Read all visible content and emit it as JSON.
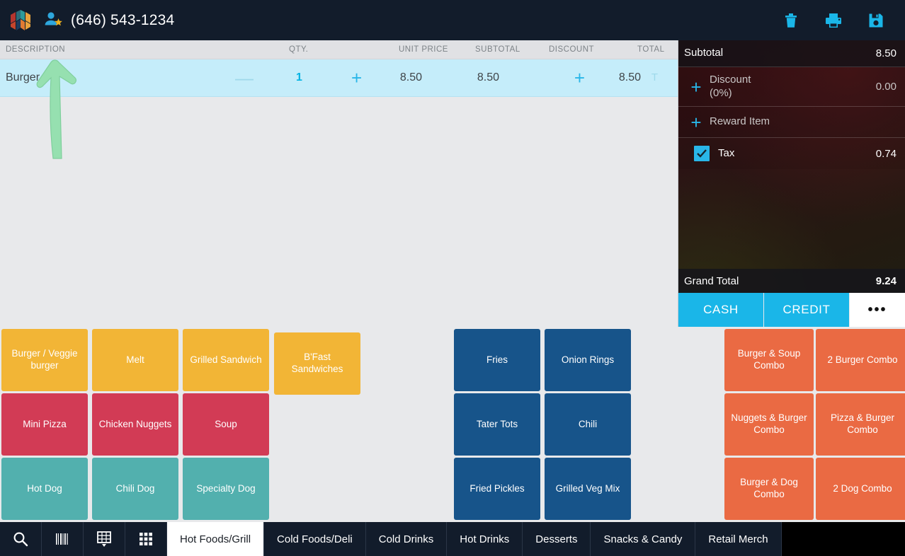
{
  "header": {
    "logo_icon": "leaf-logo-icon",
    "customer_icon": "customer-star-icon",
    "phone_number": "(646) 543-1234",
    "actions": [
      {
        "icon": "trash-icon",
        "label": "Delete"
      },
      {
        "icon": "print-icon",
        "label": "Print"
      },
      {
        "icon": "save-icon",
        "label": "Save"
      }
    ],
    "accent_color": "#1ab6e8",
    "background_color": "#121c2b"
  },
  "ticket": {
    "columns": {
      "description": "DESCRIPTION",
      "qty": "QTY.",
      "unit_price": "UNIT PRICE",
      "subtotal": "SUBTOTAL",
      "discount": "DISCOUNT",
      "total": "TOTAL"
    },
    "rows": [
      {
        "description": "Burger",
        "minus": "—",
        "qty": "1",
        "plus": "+",
        "unit_price": "8.50",
        "subtotal": "8.50",
        "discount_plus": "+",
        "total": "8.50",
        "tax_flag": "T"
      }
    ]
  },
  "totals": {
    "subtotal_label": "Subtotal",
    "subtotal_value": "8.50",
    "discount_label": "Discount",
    "discount_percent": "(0%)",
    "discount_value": "0.00",
    "discount_add": "+",
    "reward_label": "Reward Item",
    "reward_add": "+",
    "tax_label": "Tax",
    "tax_value": "0.74",
    "tax_checked": true,
    "grand_total_label": "Grand Total",
    "grand_total_value": "9.24",
    "cash_label": "CASH",
    "credit_label": "CREDIT",
    "more_label": "•••"
  },
  "grids": {
    "left": [
      {
        "label": "Burger / Veggie burger",
        "color": "yellow"
      },
      {
        "label": "Melt",
        "color": "yellow"
      },
      {
        "label": "Grilled Sandwich",
        "color": "yellow"
      },
      {
        "label": "B'Fast Sandwiches",
        "color": "yellow"
      },
      {
        "label": "Mini Pizza",
        "color": "red"
      },
      {
        "label": "Chicken Nuggets",
        "color": "red"
      },
      {
        "label": "Soup",
        "color": "red"
      },
      {
        "label": "Hot Dog",
        "color": "teal"
      },
      {
        "label": "Chili Dog",
        "color": "teal"
      },
      {
        "label": "Specialty Dog",
        "color": "teal"
      }
    ],
    "middle": [
      {
        "label": "Fries",
        "color": "blue"
      },
      {
        "label": "Onion Rings",
        "color": "blue"
      },
      {
        "label": "Tater Tots",
        "color": "blue"
      },
      {
        "label": "Chili",
        "color": "blue"
      },
      {
        "label": "Fried Pickles",
        "color": "blue"
      },
      {
        "label": "Grilled Veg Mix",
        "color": "blue"
      }
    ],
    "right": [
      {
        "label": "Burger & Soup Combo",
        "color": "orange"
      },
      {
        "label": "2 Burger Combo",
        "color": "orange"
      },
      {
        "label": "Nuggets & Burger Combo",
        "color": "orange"
      },
      {
        "label": "Pizza & Burger Combo",
        "color": "orange"
      },
      {
        "label": "Burger & Dog Combo",
        "color": "orange"
      },
      {
        "label": "2 Dog Combo",
        "color": "orange"
      }
    ],
    "colors": {
      "yellow": "#f2b536",
      "red": "#d23b55",
      "teal": "#52b0ae",
      "blue": "#17548a",
      "orange": "#ea6a43"
    }
  },
  "bottombar": {
    "icons": [
      {
        "icon": "search-icon"
      },
      {
        "icon": "barcode-icon"
      },
      {
        "icon": "keypad-dropdown-icon"
      },
      {
        "icon": "apps-grid-icon"
      }
    ],
    "tabs": [
      {
        "label": "Hot Foods/Grill",
        "active": true
      },
      {
        "label": "Cold Foods/Deli",
        "active": false
      },
      {
        "label": "Cold Drinks",
        "active": false
      },
      {
        "label": "Hot Drinks",
        "active": false
      },
      {
        "label": "Desserts",
        "active": false
      },
      {
        "label": "Snacks & Candy",
        "active": false
      },
      {
        "label": "Retail Merch",
        "active": false
      }
    ]
  },
  "annotation": {
    "arrow_icon": "green-up-arrow-annotation",
    "color": "#96e0b0",
    "points_to": "customer-star-icon"
  }
}
